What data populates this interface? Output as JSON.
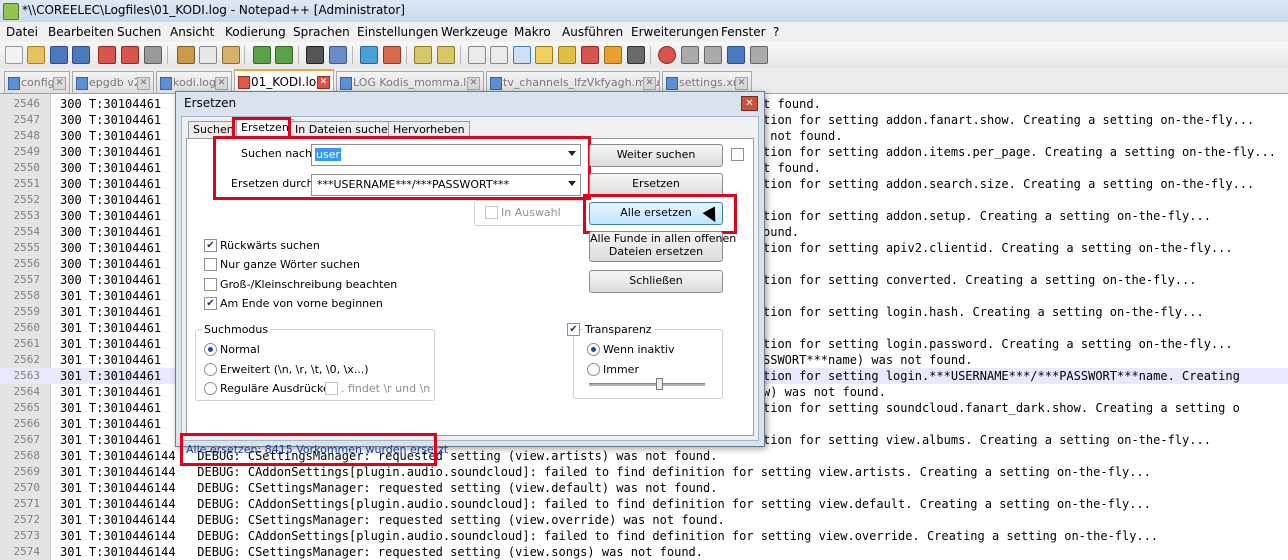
{
  "window": {
    "title": "*\\\\COREELEC\\Logfiles\\01_KODI.log - Notepad++ [Administrator]"
  },
  "menu": [
    "Datei",
    "Bearbeiten",
    "Suchen",
    "Ansicht",
    "Kodierung",
    "Sprachen",
    "Einstellungen",
    "Werkzeuge",
    "Makro",
    "Ausführen",
    "Erweiterungen",
    "Fenster",
    "?"
  ],
  "tabs": [
    {
      "label": "config",
      "active": false
    },
    {
      "label": "epgdb v2",
      "active": false
    },
    {
      "label": "kodi.log",
      "active": false
    },
    {
      "label": "01_KODI.log",
      "active": true
    },
    {
      "label": "LOG Kodis_momma.log",
      "active": false
    },
    {
      "label": "tv_channels_lfzVkfyagh.m3u",
      "active": false
    },
    {
      "label": "settings.xml",
      "active": false
    }
  ],
  "editor": {
    "lines": [
      {
        "n": "2546",
        "text": "300 T:30104461",
        "rest": "t found."
      },
      {
        "n": "2547",
        "text": "300 T:30104461",
        "rest": "tion for setting addon.fanart.show. Creating a setting on-the-fly..."
      },
      {
        "n": "2548",
        "text": "300 T:30104461",
        "rest": " not found."
      },
      {
        "n": "2549",
        "text": "300 T:30104461",
        "rest": "tion for setting addon.items.per_page. Creating a setting on-the-fly..."
      },
      {
        "n": "2550",
        "text": "300 T:30104461",
        "rest": "t found."
      },
      {
        "n": "2551",
        "text": "300 T:30104461",
        "rest": "tion for setting addon.search.size. Creating a setting on-the-fly..."
      },
      {
        "n": "2552",
        "text": "300 T:30104461",
        "rest": ""
      },
      {
        "n": "2553",
        "text": "300 T:30104461",
        "rest": "tion for setting addon.setup. Creating a setting on-the-fly..."
      },
      {
        "n": "2554",
        "text": "300 T:30104461",
        "rest": "ound."
      },
      {
        "n": "2555",
        "text": "300 T:30104461",
        "rest": "tion for setting apiv2.clientid. Creating a setting on-the-fly..."
      },
      {
        "n": "2556",
        "text": "300 T:30104461",
        "rest": ""
      },
      {
        "n": "2557",
        "text": "300 T:30104461",
        "rest": "tion for setting converted. Creating a setting on-the-fly..."
      },
      {
        "n": "2558",
        "text": "301 T:30104461",
        "rest": ""
      },
      {
        "n": "2559",
        "text": "301 T:30104461",
        "rest": "tion for setting login.hash. Creating a setting on-the-fly..."
      },
      {
        "n": "2560",
        "text": "301 T:30104461",
        "rest": ""
      },
      {
        "n": "2561",
        "text": "301 T:30104461",
        "rest": "tion for setting login.password. Creating a setting on-the-fly..."
      },
      {
        "n": "2562",
        "text": "301 T:30104461",
        "rest": "SSWORT***name) was not found."
      },
      {
        "n": "2563",
        "text": "301 T:30104461",
        "rest": "tion for setting login.***USERNAME***/***PASSWORT***name. Creating",
        "hl": true
      },
      {
        "n": "2564",
        "text": "301 T:30104461",
        "rest": "w) was not found."
      },
      {
        "n": "2565",
        "text": "301 T:30104461",
        "rest": "tion for setting soundcloud.fanart_dark.show. Creating a setting o"
      },
      {
        "n": "2566",
        "text": "301 T:30104461",
        "rest": ""
      },
      {
        "n": "2567",
        "text": "301 T:30104461",
        "rest": "tion for setting view.albums. Creating a setting on-the-fly..."
      },
      {
        "n": "2568",
        "text": "301 T:3010446144   DEBUG: CSettingsManager: requested setting (view.artists) was not found.",
        "rest": ""
      },
      {
        "n": "2569",
        "text": "301 T:3010446144   DEBUG: CAddonSettings[plugin.audio.soundcloud]: failed to find definition for setting view.artists. Creating a setting on-the-fly...",
        "rest": ""
      },
      {
        "n": "2570",
        "text": "301 T:3010446144   DEBUG: CSettingsManager: requested setting (view.default) was not found.",
        "rest": ""
      },
      {
        "n": "2571",
        "text": "301 T:3010446144   DEBUG: CAddonSettings[plugin.audio.soundcloud]: failed to find definition for setting view.default. Creating a setting on-the-fly...",
        "rest": ""
      },
      {
        "n": "2572",
        "text": "301 T:3010446144   DEBUG: CSettingsManager: requested setting (view.override) was not found.",
        "rest": ""
      },
      {
        "n": "2573",
        "text": "301 T:3010446144   DEBUG: CAddonSettings[plugin.audio.soundcloud]: failed to find definition for setting view.override. Creating a setting on-the-fly...",
        "rest": ""
      },
      {
        "n": "2574",
        "text": "301 T:3010446144   DEBUG: CSettingsManager: requested setting (view.songs) was not found.",
        "rest": ""
      }
    ]
  },
  "dialog": {
    "title": "Ersetzen",
    "tabs": [
      "Suchen",
      "Ersetzen",
      "In Dateien suchen",
      "Hervorheben"
    ],
    "find_label": "Suchen nach:",
    "find_value": "user",
    "replace_label": "Ersetzen durch:",
    "replace_value": "***USERNAME***/***PASSWORT***",
    "in_selection": "In Auswahl",
    "options": [
      {
        "label": "Rückwärts suchen",
        "checked": true
      },
      {
        "label": "Nur ganze Wörter suchen",
        "checked": false
      },
      {
        "label": "Groß-/Kleinschreibung beachten",
        "checked": false
      },
      {
        "label": "Am Ende von vorne beginnen",
        "checked": true
      }
    ],
    "search_mode_title": "Suchmodus",
    "search_modes": [
      {
        "label": "Normal",
        "checked": true
      },
      {
        "label": "Erweitert (\\n, \\r, \\t, \\0, \\x...)",
        "checked": false
      },
      {
        "label": "Reguläre Ausdrücke",
        "checked": false
      }
    ],
    "dot_newline": ". findet \\r und \\n",
    "transparency_label": "Transparenz",
    "transparency_modes": [
      {
        "label": "Wenn inaktiv",
        "checked": true
      },
      {
        "label": "Immer",
        "checked": false
      }
    ],
    "transparency_level": 0.6,
    "buttons": {
      "find_next": "Weiter suchen",
      "replace": "Ersetzen",
      "replace_all": "Alle ersetzen",
      "replace_all_open_line1": "Alle Funde in allen offenen",
      "replace_all_open_line2": "Dateien ersetzen",
      "close": "Schließen"
    },
    "status": "Alle ersetzen: 8415 Vorkommen wurden ersetzt"
  },
  "colors": {
    "highlight_red": "#e2001a",
    "status_blue": "#1b3ea3"
  }
}
